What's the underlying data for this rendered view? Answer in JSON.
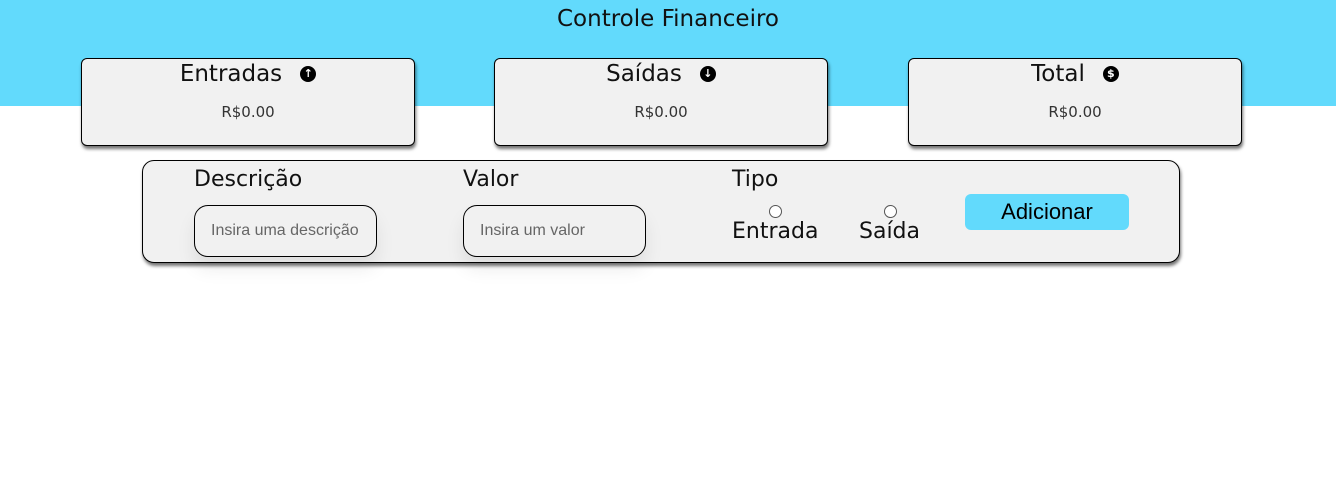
{
  "header": {
    "title": "Controle Financeiro",
    "background_color": "#62dafc"
  },
  "cards": [
    {
      "title": "Entradas",
      "icon": "arrow-up-circle-icon",
      "value": "R$0.00"
    },
    {
      "title": "Saídas",
      "icon": "arrow-down-circle-icon",
      "value": "R$0.00"
    },
    {
      "title": "Total",
      "icon": "dollar-circle-icon",
      "value": "R$0.00"
    }
  ],
  "form": {
    "description": {
      "label": "Descrição",
      "placeholder": "Insira uma descrição",
      "value": ""
    },
    "amount": {
      "label": "Valor",
      "placeholder": "Insira um valor",
      "value": ""
    },
    "type": {
      "label": "Tipo",
      "options": [
        "Entrada",
        "Saída"
      ],
      "selected": null
    },
    "submit_label": "Adicionar",
    "submit_color": "#62dafc"
  }
}
